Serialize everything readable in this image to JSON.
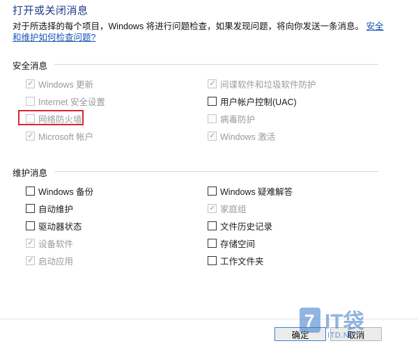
{
  "header": {
    "title": "打开或关闭消息",
    "description": "对于所选择的每个项目，Windows 将进行问题检查，如果发现问题，将向你发送一条消息。",
    "link": "安全和维护如何检查问题?"
  },
  "security": {
    "label": "安全消息",
    "items": [
      {
        "label": "Windows 更新",
        "checked": true,
        "disabled": true
      },
      {
        "label": "间谍软件和垃圾软件防护",
        "checked": true,
        "disabled": true
      },
      {
        "label": "Internet 安全设置",
        "checked": false,
        "disabled": true
      },
      {
        "label": "用户帐户控制(UAC)",
        "checked": false,
        "disabled": false
      },
      {
        "label": "网络防火墙",
        "checked": false,
        "disabled": true
      },
      {
        "label": "病毒防护",
        "checked": false,
        "disabled": true
      },
      {
        "label": "Microsoft 帐户",
        "checked": true,
        "disabled": true
      },
      {
        "label": "Windows 激活",
        "checked": true,
        "disabled": true
      }
    ]
  },
  "maintenance": {
    "label": "维护消息",
    "items": [
      {
        "label": "Windows 备份",
        "checked": false,
        "disabled": false
      },
      {
        "label": "Windows 疑难解答",
        "checked": false,
        "disabled": false
      },
      {
        "label": "自动维护",
        "checked": false,
        "disabled": false
      },
      {
        "label": "家庭组",
        "checked": true,
        "disabled": true
      },
      {
        "label": "驱动器状态",
        "checked": false,
        "disabled": false
      },
      {
        "label": "文件历史记录",
        "checked": false,
        "disabled": false
      },
      {
        "label": "设备软件",
        "checked": true,
        "disabled": true
      },
      {
        "label": "存储空间",
        "checked": false,
        "disabled": false
      },
      {
        "label": "启动应用",
        "checked": true,
        "disabled": true
      },
      {
        "label": "工作文件夹",
        "checked": false,
        "disabled": false
      }
    ]
  },
  "footer": {
    "ok_label": "确定",
    "cancel_label": "取消"
  },
  "watermark": {
    "logo_text": "IT袋",
    "site_text": "ITD.NET"
  },
  "colors": {
    "title": "#1e3b8a",
    "link": "#1655b8",
    "highlight": "#d9262e"
  }
}
